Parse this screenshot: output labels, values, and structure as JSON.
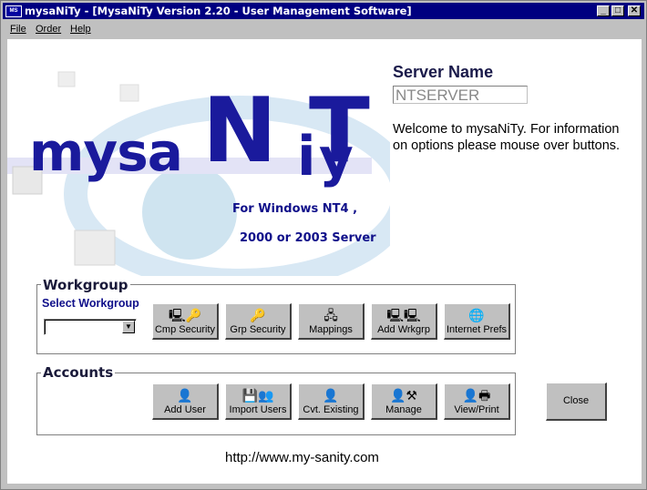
{
  "window": {
    "title": "mysaNiTy - [MysaNiTy Version 2.20 - User Management Software]",
    "app_icon_text": "MS",
    "minimize": "_",
    "maximize": "□",
    "close": "✕"
  },
  "menu": {
    "file": "File",
    "order": "Order",
    "help": "Help"
  },
  "logo": {
    "part1": "mysa",
    "n": "N",
    "i": "i",
    "t": "T",
    "y": "y"
  },
  "os": {
    "line1": "For Windows NT4 ,",
    "line2": "2000 or 2003 Server"
  },
  "server": {
    "label": "Server Name",
    "value": "NTSERVER"
  },
  "welcome": "Welcome to mysaNiTy. For information on options please mouse over buttons.",
  "workgroup": {
    "title": "Workgroup",
    "select_label": "Select Workgroup",
    "selected": "",
    "buttons": [
      {
        "label": "Cmp Security",
        "icon": "computer-key-icon",
        "glyph": "🖳🔑"
      },
      {
        "label": "Grp Security",
        "icon": "key-icon",
        "glyph": "🔑"
      },
      {
        "label": "Mappings",
        "icon": "network-drive-icon",
        "glyph": "🖧"
      },
      {
        "label": "Add Wrkgrp",
        "icon": "computers-icon",
        "glyph": "🖳🖳"
      },
      {
        "label": "Internet Prefs",
        "icon": "globe-icon",
        "glyph": "🌐"
      }
    ]
  },
  "accounts": {
    "title": "Accounts",
    "buttons": [
      {
        "label": "Add User",
        "icon": "user-icon",
        "glyph": "👤"
      },
      {
        "label": "Import Users",
        "icon": "disk-users-icon",
        "glyph": "💾👥"
      },
      {
        "label": "Cvt. Existing",
        "icon": "user-convert-icon",
        "glyph": "👤"
      },
      {
        "label": "Manage",
        "icon": "user-tools-icon",
        "glyph": "👤⚒"
      },
      {
        "label": "View/Print",
        "icon": "user-printer-icon",
        "glyph": "👤🖶"
      }
    ]
  },
  "close_label": "Close",
  "url": "http://www.my-sanity.com"
}
